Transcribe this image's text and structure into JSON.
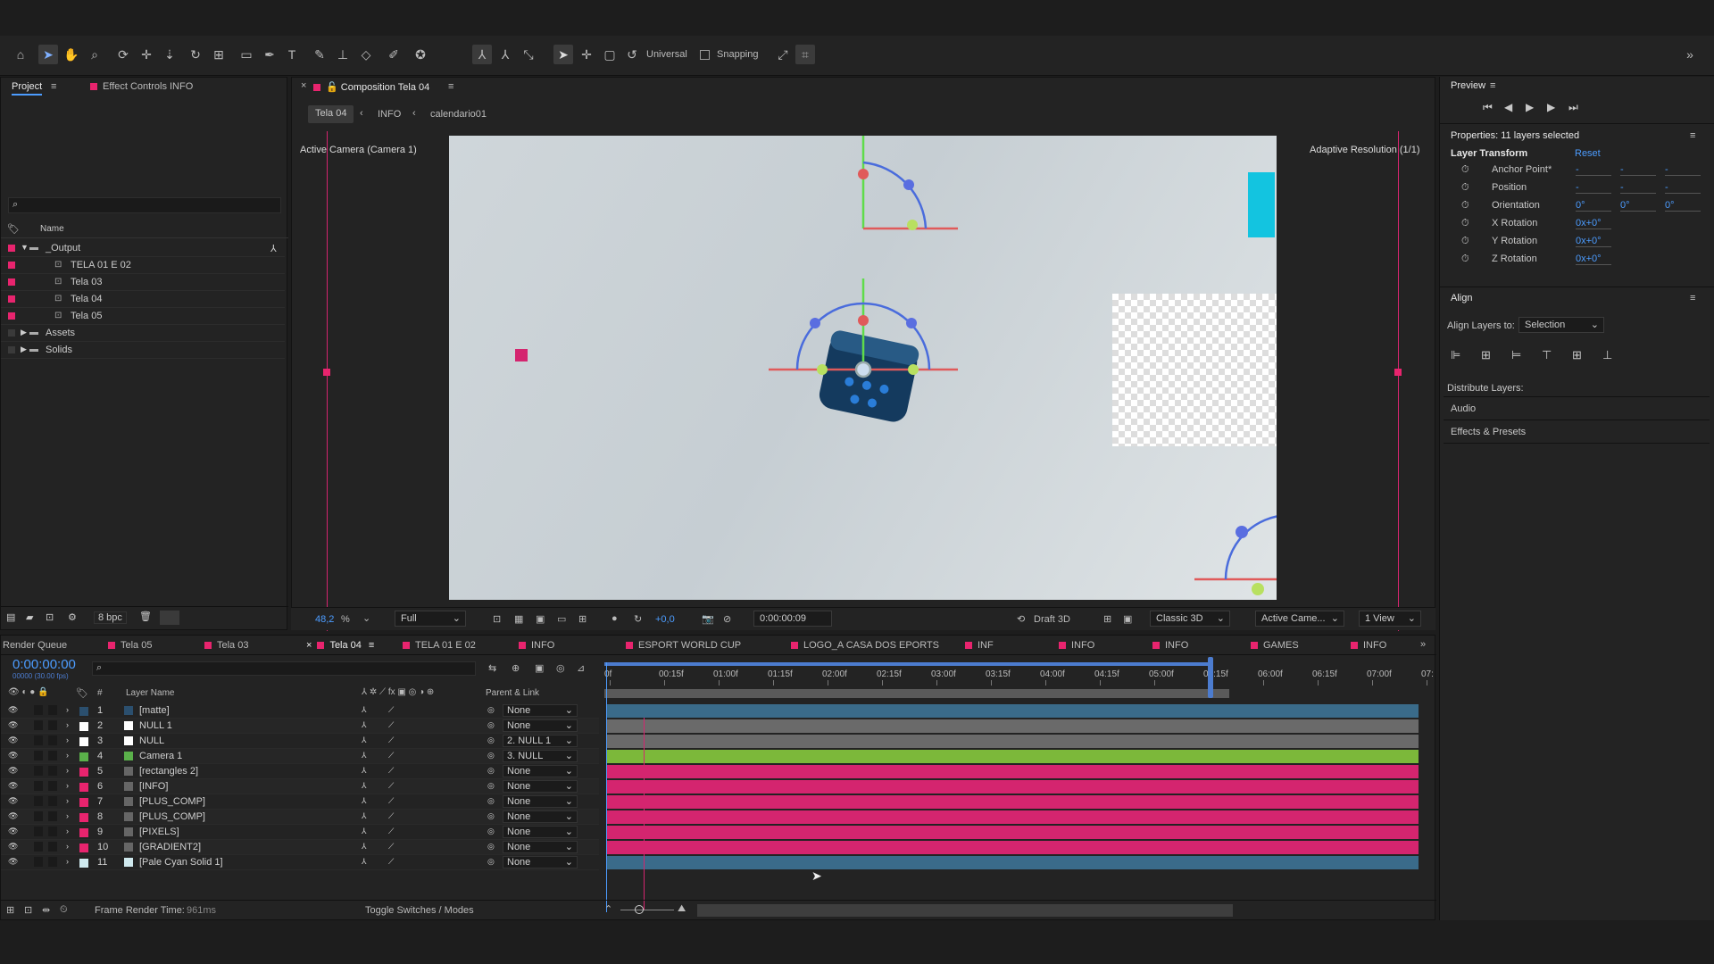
{
  "toolbar": {
    "universal_label": "Universal",
    "snapping_label": "Snapping"
  },
  "project_panel": {
    "tab_project": "Project",
    "tab_effect_controls": "Effect Controls INFO",
    "name_col": "Name",
    "items": [
      {
        "label": "_Output",
        "type": "folder-open"
      },
      {
        "label": "TELA 01 E 02",
        "type": "comp"
      },
      {
        "label": "Tela 03",
        "type": "comp"
      },
      {
        "label": "Tela 04",
        "type": "comp"
      },
      {
        "label": "Tela 05",
        "type": "comp"
      },
      {
        "label": "Assets",
        "type": "folder"
      },
      {
        "label": "Solids",
        "type": "folder"
      }
    ],
    "bpc": "8 bpc"
  },
  "viewer": {
    "tab_title": "Composition Tela 04",
    "breadcrumb": [
      "Tela 04",
      "INFO",
      "calendario01"
    ],
    "camera_label": "Active Camera (Camera 1)",
    "resolution_label": "Adaptive Resolution (1/1)",
    "zoom": "48,2",
    "zoom_unit": "%",
    "quality": "Full",
    "exposure": "+0,0",
    "timecode": "0:00:00:09",
    "draft": "Draft 3D",
    "renderer": "Classic 3D",
    "view_camera": "Active Came...",
    "view_count": "1 View"
  },
  "timeline": {
    "tabs": [
      "Render Queue",
      "Tela 05",
      "Tela 03",
      "Tela 04",
      "TELA 01 E 02",
      "INFO",
      "ESPORT WORLD CUP",
      "LOGO_A CASA DOS EPORTS",
      "INF",
      "INFO",
      "INFO",
      "GAMES",
      "INFO"
    ],
    "timecode": "0:00:00:00",
    "fps": "00000 (30.00 fps)",
    "col_hash": "#",
    "col_layer_name": "Layer Name",
    "col_parent": "Parent & Link",
    "ruler": [
      "0f",
      "00:15f",
      "01:00f",
      "01:15f",
      "02:00f",
      "02:15f",
      "03:00f",
      "03:15f",
      "04:00f",
      "04:15f",
      "05:00f",
      "05:15f",
      "06:00f",
      "06:15f",
      "07:00f",
      "07:"
    ],
    "layers": [
      {
        "n": "1",
        "name": "[matte]",
        "color": "#2b4f6e",
        "parent": "None",
        "bar": "#3a6b8a"
      },
      {
        "n": "2",
        "name": "NULL 1",
        "color": "#ffffff",
        "parent": "None",
        "bar": "#6a6a6a"
      },
      {
        "n": "3",
        "name": "NULL",
        "color": "#ffffff",
        "parent": "2. NULL 1",
        "bar": "#6a6a6a"
      },
      {
        "n": "4",
        "name": "Camera 1",
        "color": "#5ab04a",
        "parent": "3. NULL",
        "bar": "#7cb83a"
      },
      {
        "n": "5",
        "name": "[rectangles 2]",
        "color": "#e8246e",
        "parent": "None",
        "bar": "#d4256f"
      },
      {
        "n": "6",
        "name": "[INFO]",
        "color": "#e8246e",
        "parent": "None",
        "bar": "#d4256f"
      },
      {
        "n": "7",
        "name": "[PLUS_COMP]",
        "color": "#e8246e",
        "parent": "None",
        "bar": "#d4256f"
      },
      {
        "n": "8",
        "name": "[PLUS_COMP]",
        "color": "#e8246e",
        "parent": "None",
        "bar": "#d4256f"
      },
      {
        "n": "9",
        "name": "[PIXELS]",
        "color": "#e8246e",
        "parent": "None",
        "bar": "#d4256f"
      },
      {
        "n": "10",
        "name": "[GRADIENT2]",
        "color": "#e8246e",
        "parent": "None",
        "bar": "#d4256f"
      },
      {
        "n": "11",
        "name": "[Pale Cyan Solid 1]",
        "color": "#cfe9ee",
        "parent": "None",
        "bar": "#3a6b8a"
      }
    ],
    "frame_render_label": "Frame Render Time:",
    "frame_render_value": "961ms",
    "toggle_label": "Toggle Switches / Modes"
  },
  "preview": {
    "title": "Preview"
  },
  "properties": {
    "title": "Properties: 11 layers selected",
    "section": "Layer Transform",
    "reset": "Reset",
    "rows": [
      {
        "label": "Anchor Point*",
        "vals": [
          "-",
          "-",
          "-"
        ]
      },
      {
        "label": "Position",
        "vals": [
          "-",
          "-",
          "-"
        ]
      },
      {
        "label": "Orientation",
        "vals": [
          "0°",
          "0°",
          "0°"
        ]
      },
      {
        "label": "X Rotation",
        "vals": [
          "0x+0°"
        ]
      },
      {
        "label": "Y Rotation",
        "vals": [
          "0x+0°"
        ]
      },
      {
        "label": "Z Rotation",
        "vals": [
          "0x+0°"
        ]
      }
    ]
  },
  "align": {
    "title": "Align",
    "align_to_label": "Align Layers to:",
    "align_to_value": "Selection",
    "distribute_label": "Distribute Layers:",
    "audio": "Audio",
    "effects": "Effects & Presets"
  }
}
